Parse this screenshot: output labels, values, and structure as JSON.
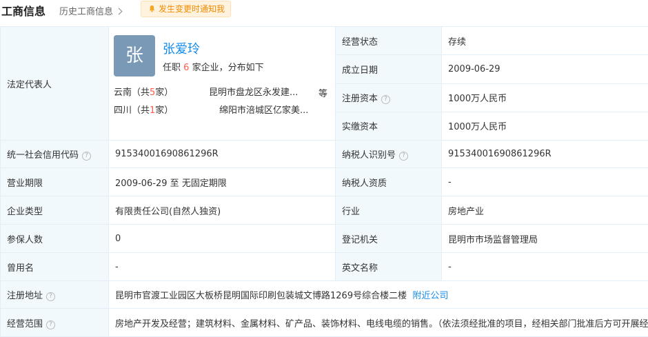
{
  "header": {
    "title": "工商信息",
    "history_link": "历史工商信息",
    "notify_button": "发生变更时通知我"
  },
  "legal_rep": {
    "label": "法定代表人",
    "avatar_char": "张",
    "name": "张爱玲",
    "positions_prefix": "任职",
    "positions_count": "6",
    "positions_suffix": "家企业，分布如下",
    "regions": [
      {
        "region_prefix": "云南（共",
        "count": "5",
        "region_suffix": "家）",
        "company": "昆明市盘龙区永发建..."
      },
      {
        "region_prefix": "四川（共",
        "count": "1",
        "region_suffix": "家）",
        "company": "绵阳市涪城区亿家美..."
      }
    ],
    "more": "等"
  },
  "right_top": [
    {
      "label": "经营状态",
      "value": "存续"
    },
    {
      "label": "成立日期",
      "value": "2009-06-29"
    },
    {
      "label": "注册资本",
      "value": "1000万人民币"
    },
    {
      "label": "实缴资本",
      "value": "1000万人民币"
    }
  ],
  "rows": [
    {
      "l1": "统一社会信用代码",
      "v1": "91534001690861296R",
      "l2": "纳税人识别号",
      "v2": "91534001690861296R"
    },
    {
      "l1": "营业期限",
      "v1": "2009-06-29 至 无固定期限",
      "l2": "纳税人资质",
      "v2": "-"
    },
    {
      "l1": "企业类型",
      "v1": "有限责任公司(自然人独资)",
      "l2": "行业",
      "v2": "房地产业"
    },
    {
      "l1": "参保人数",
      "v1": "0",
      "l2": "登记机关",
      "v2": "昆明市市场监督管理局"
    },
    {
      "l1": "曾用名",
      "v1": "-",
      "l2": "英文名称",
      "v2": "-"
    }
  ],
  "address": {
    "label": "注册地址",
    "value": "昆明市官渡工业园区大板桥昆明国际印刷包装城文博路1269号综合楼二楼",
    "link": "附近公司"
  },
  "scope": {
    "label": "经营范围",
    "value": "房地产开发及经营；建筑材料、金属材料、矿产品、装饰材料、电线电缆的销售。（依法须经批准的项目，经相关部门批准后方可开展经营活动）"
  },
  "icons": {
    "help": "question-circle-icon",
    "bell": "bell-icon",
    "chevron": "chevron-right-icon"
  },
  "colors": {
    "label_bg": "#f2f9fc",
    "border": "#e4eef6",
    "link": "#128bed",
    "accent_red": "#ff5a4a",
    "notify_text": "#f28b00",
    "avatar_bg": "#7a99b7"
  }
}
